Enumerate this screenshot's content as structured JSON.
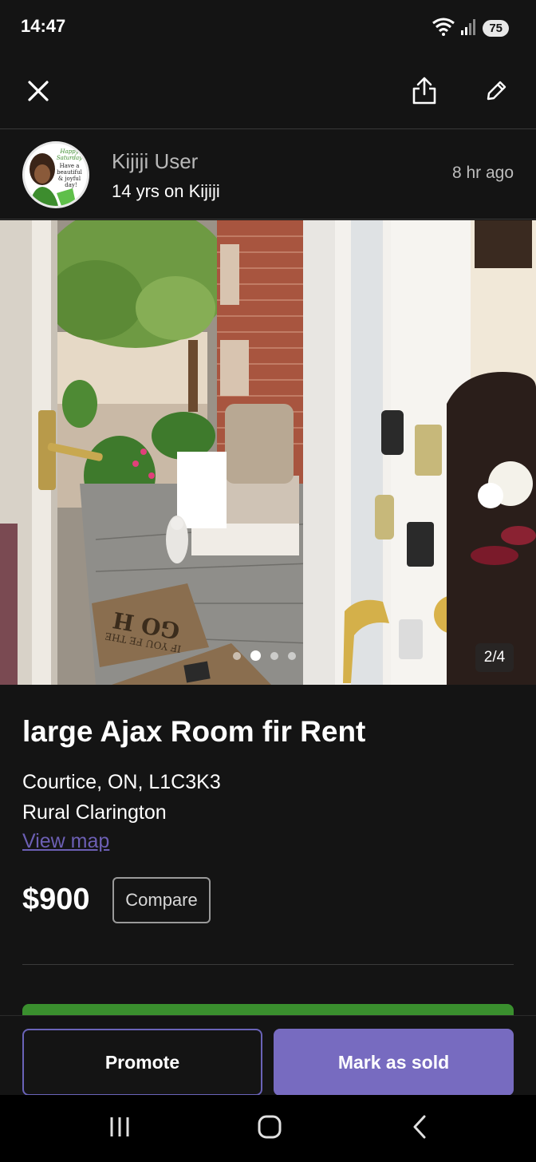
{
  "status_bar": {
    "time": "14:47",
    "battery": "75",
    "icons": [
      "wifi-icon",
      "signal-icon",
      "battery-icon"
    ]
  },
  "toolbar": {
    "icons": [
      "close-icon",
      "share-icon",
      "edit-icon"
    ]
  },
  "seller": {
    "name": "Kijiji User",
    "member_since": "14 yrs on Kijiji",
    "posted": "8 hr  ago",
    "avatar_text": [
      "Happy",
      "Saturday",
      "Have a",
      "beautiful",
      "& joyful",
      "day!"
    ]
  },
  "gallery": {
    "counter": "2/4",
    "dot_count": 4,
    "active_dot": 1,
    "doormat_text": "GO H",
    "doormat_sub": "IF YOU FE THE"
  },
  "listing": {
    "title": "large Ajax Room fir Rent",
    "location_line1": "Courtice, ON, L1C3K3",
    "location_line2": "Rural Clarington",
    "view_map": "View map",
    "price": "$900",
    "compare": "Compare"
  },
  "actions": {
    "promote": "Promote",
    "mark_sold": "Mark as sold"
  },
  "nav": {
    "icons": [
      "recents-icon",
      "home-icon",
      "back-icon"
    ]
  },
  "colors": {
    "background": "#141414",
    "accent": "#776bc0",
    "link": "#6c5fb4",
    "green": "#3a8f2e"
  }
}
